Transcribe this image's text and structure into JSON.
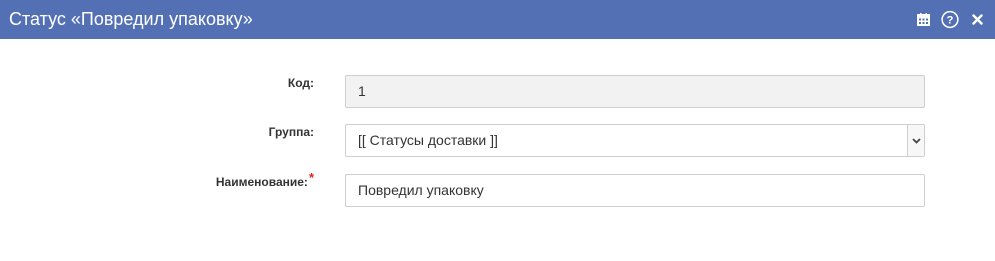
{
  "window": {
    "title": "Статус «Повредил упаковку»",
    "icons": [
      "calendar-icon",
      "help-icon",
      "close-icon"
    ],
    "titlebar_color": "#5470b4"
  },
  "form": {
    "code": {
      "label": "Код:",
      "value": "1"
    },
    "group": {
      "label": "Группа:",
      "selected": "[[ Статусы доставки ]]"
    },
    "name": {
      "label": "Наименование:",
      "required_mark": "*",
      "value": "Повредил упаковку"
    }
  }
}
